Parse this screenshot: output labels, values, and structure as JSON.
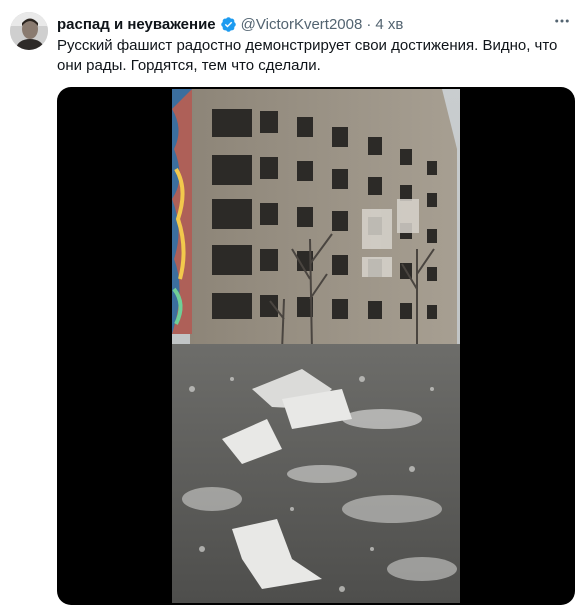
{
  "tweet": {
    "author_name": "распад и неуважение",
    "handle": "@VictorKvert2008",
    "separator": "·",
    "time": "4 хв",
    "text": "Русский фашист радостно демонстрирует свои достижения. Видно, что они рады. Гордятся, тем что сделали."
  },
  "icons": {
    "verified": "verified-badge-icon",
    "more": "more-dots-icon"
  },
  "colors": {
    "verified_blue": "#1d9bf0",
    "secondary_text": "#536471",
    "primary_text": "#0f1419"
  }
}
